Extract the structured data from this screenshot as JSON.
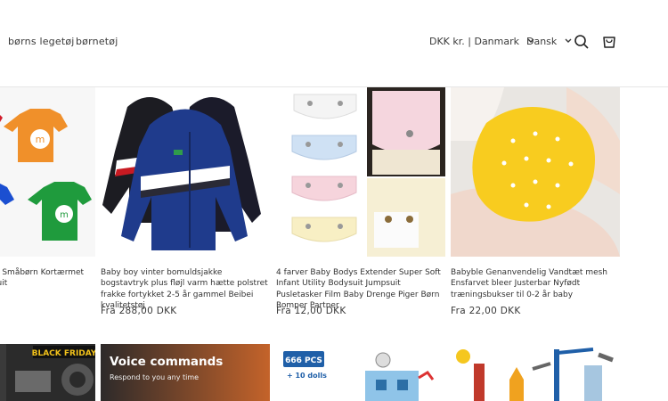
{
  "header": {
    "nav": [
      "børns legetøj",
      "børnetøj"
    ],
    "currency": "DKK kr. | Danmark",
    "language": "Dansk",
    "icons": [
      "search-icon",
      "cart-icon",
      "chevron-down-icon"
    ]
  },
  "products": [
    {
      "title": "ensfarvet mode til Småbørn Kortærmet Pige Dreng Bodysuit",
      "price": ""
    },
    {
      "title": "Baby boy vinter bomuldsjakke bogstavtryk plus fløjl varm hætte polstret frakke fortykket 2-5 år gammel Beibei kvalitetstøj",
      "price": "Fra 288,00 DKK"
    },
    {
      "title": "4 farver Baby Bodys Extender Super Soft Infant Utility Bodysuit Jumpsuit Pusletasker Film Baby Drenge Piger Børn Romper Partner",
      "price": "Fra 12,00 DKK"
    },
    {
      "title": "Babyble Genanvendelig Vandtæt mesh Ensfarvet bleer Justerbar Nyfødt træningsbukser til 0-2 år baby",
      "price": "Fra 22,00 DKK"
    }
  ],
  "promo": {
    "black_friday": "BLACK FRIDAY",
    "voice_title": "Voice commands",
    "voice_sub": "Respond to you any time",
    "pcs_badge": "666 PCS",
    "dolls": "+ 10 dolls"
  },
  "colors": {
    "accent": "#1f5fa8",
    "text": "#121212",
    "muted": "#3a3a3a"
  }
}
